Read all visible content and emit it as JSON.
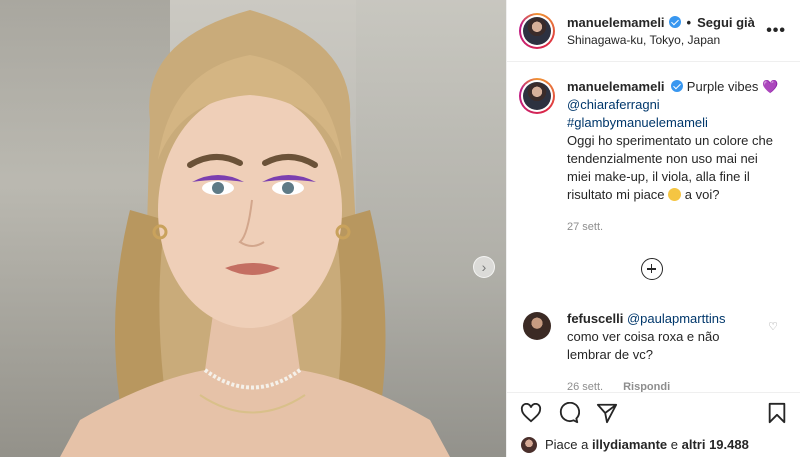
{
  "post": {
    "username": "manuelemameli",
    "follow_separator": "•",
    "follow_label": "Segui già",
    "location": "Shinagawa-ku, Tokyo, Japan",
    "more_label": "•••",
    "next_label": "›"
  },
  "caption": {
    "username": "manuelemameli",
    "text_1": "Purple vibes",
    "heart": "💜",
    "mention": "@chiaraferragni",
    "hashtag": "#glambymanuelemameli",
    "text_2": "Oggi ho sperimentato un colore che tendenzialmente non uso mai nei miei make-up, il viola, alla fine il risultato mi piace",
    "text_3": "a voi?",
    "time": "27 sett."
  },
  "comments": [
    {
      "username": "fefuscelli",
      "mention": "@paulapmarttins",
      "text": "como ver coisa roxa e não lembrar de vc?",
      "time": "26 sett.",
      "reply_label": "Rispondi",
      "heart": "♡"
    }
  ],
  "likes": {
    "prefix": "Piace a",
    "user": "illydiamante",
    "joiner": "e",
    "others": "altri 19.488"
  },
  "colors": {
    "link": "#00376b",
    "verified": "#3897f0",
    "muted": "#8e8e8e"
  }
}
